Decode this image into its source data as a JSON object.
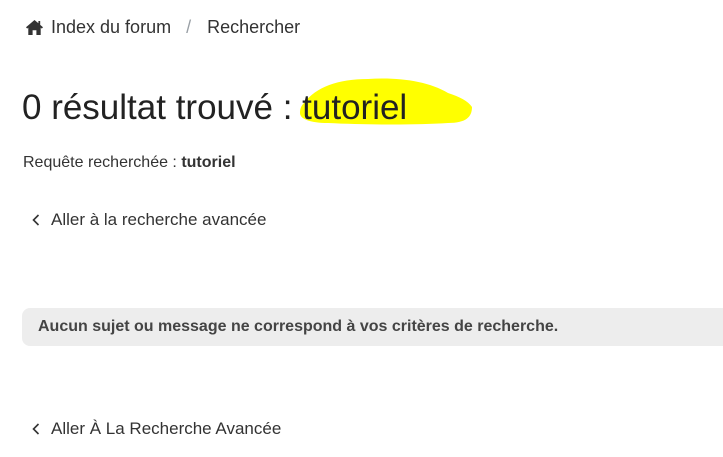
{
  "breadcrumb": {
    "home_icon": "home-icon",
    "home_label": "Index du forum",
    "separator": "/",
    "current_label": "Rechercher"
  },
  "title": {
    "prefix": "0 résultat trouvé",
    "separator": " : ",
    "keyword": "tutoriel",
    "highlight_color": "#ffff00"
  },
  "query": {
    "label": "Requête recherchée :",
    "value": "tutoriel"
  },
  "links": {
    "advanced_top": "Aller à la recherche avancée",
    "advanced_bottom": "Aller À La Recherche Avancée",
    "chevron_icon": "chevron-left-icon"
  },
  "notice": {
    "message": "Aucun sujet ou message ne correspond à vos critères de recherche.",
    "background": "#ededed"
  }
}
